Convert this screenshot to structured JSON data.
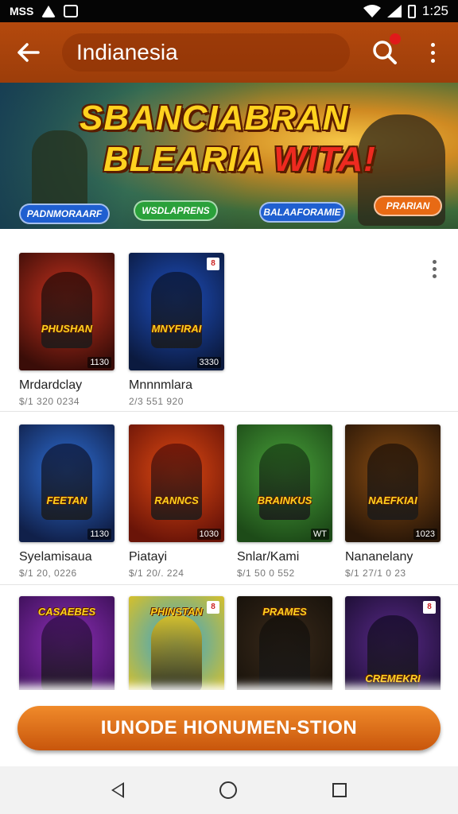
{
  "status_bar": {
    "left_icons": [
      "carrier-logo-icon",
      "warning-icon",
      "notification-icon"
    ],
    "carrier": "MSS",
    "time": "1:25"
  },
  "app_bar": {
    "title": "Indianesia"
  },
  "banner": {
    "title_line1": "SBANCIABRAN",
    "title_line2_a": "BLEARIA",
    "title_line2_b": "WITA!",
    "tags": [
      "PADNMORAARF",
      "WSDLAPRENS",
      "BALAAFORAMIE",
      "PRARIAN"
    ]
  },
  "games": [
    {
      "name": "Mrdardclay",
      "meta": "$/1 320 0234",
      "logo": "PHUSHAN",
      "count": "1130",
      "colors": [
        "#c8321e",
        "#3a0d08"
      ]
    },
    {
      "name": "Mnnnmlara",
      "meta": "2/3 551 920",
      "logo": "MNYFIRAI",
      "count": "3330",
      "colors": [
        "#1e4fbf",
        "#0b1a3f"
      ]
    },
    {
      "name": "Syelamisaua",
      "meta": "$/1 20, 0226",
      "logo": "FEETAN",
      "count": "1130",
      "colors": [
        "#2f6fd6",
        "#10204a"
      ]
    },
    {
      "name": "Piatayi",
      "meta": "$/1 20/. 224",
      "logo": "RANNCS",
      "count": "1030",
      "colors": [
        "#e04a12",
        "#6a1408"
      ]
    },
    {
      "name": "Snlar/Kami",
      "meta": "$/1 50 0 552",
      "logo": "BRAINKUS",
      "count": "WT",
      "colors": [
        "#49a23a",
        "#1d4b18"
      ]
    },
    {
      "name": "Nananelany",
      "meta": "$/1 27/1 0 23",
      "logo": "NAEFKIAI",
      "count": "1023",
      "colors": [
        "#8a4d12",
        "#2a1708"
      ]
    },
    {
      "name": "",
      "meta": "",
      "logo": "CASAEBES",
      "count": "",
      "colors": [
        "#8e2fb8",
        "#3a0f55"
      ]
    },
    {
      "name": "",
      "meta": "",
      "logo": "PHINSTAN",
      "count": "",
      "colors": [
        "#2fa3d6",
        "#e3c21d"
      ]
    },
    {
      "name": "",
      "meta": "",
      "logo": "PRAMES",
      "count": "",
      "colors": [
        "#3a2a1a",
        "#15100a"
      ]
    },
    {
      "name": "",
      "meta": "",
      "logo": "CREMEKRI",
      "count": "",
      "colors": [
        "#5a2a8a",
        "#1a0d30"
      ]
    }
  ],
  "cta": {
    "label": "IUNODE HIONUMEN-STION"
  }
}
